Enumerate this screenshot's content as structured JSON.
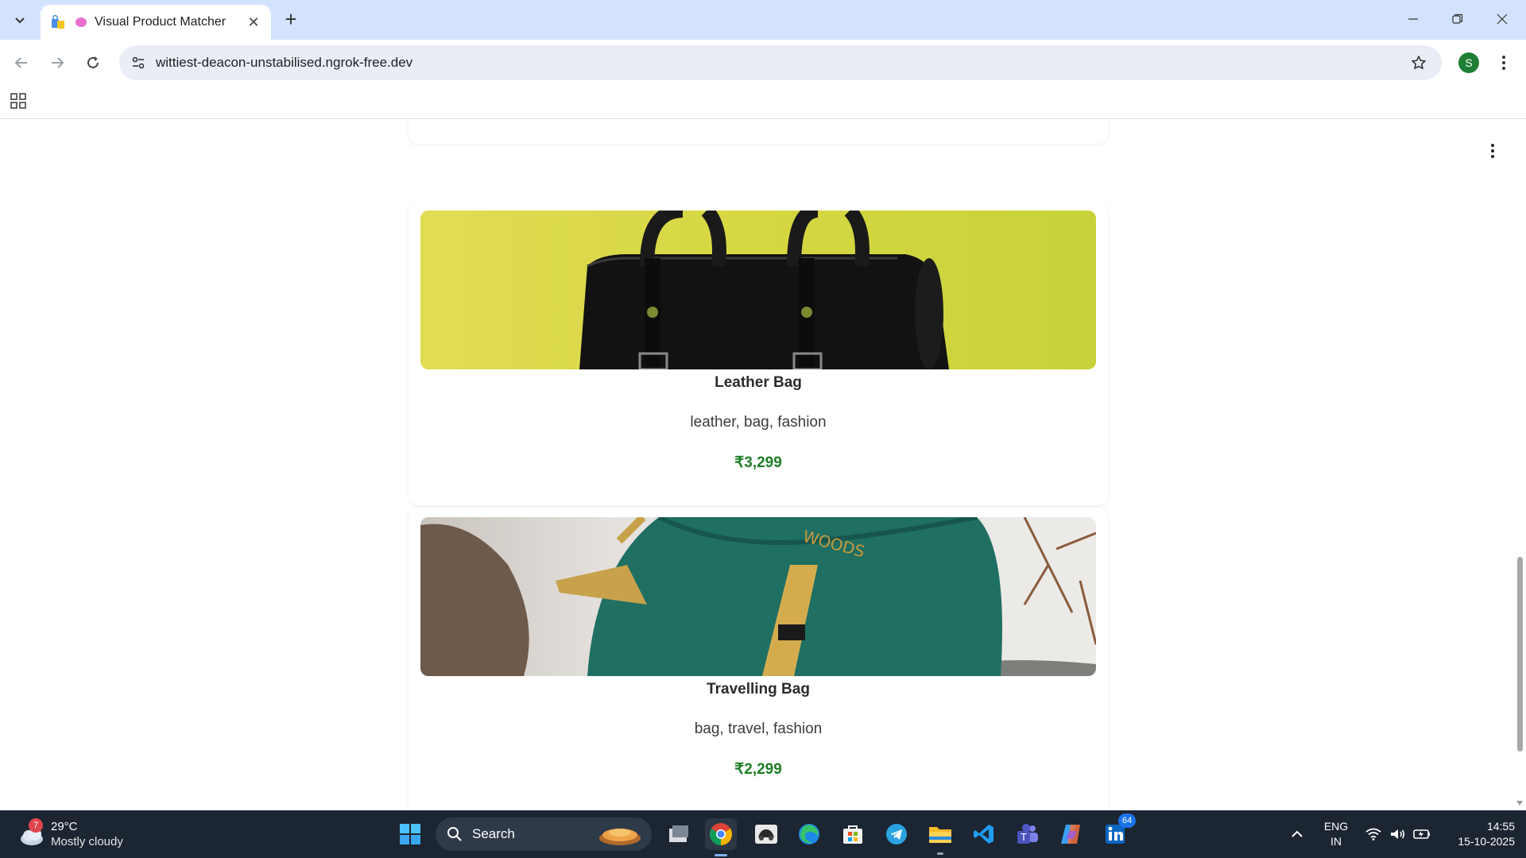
{
  "browser": {
    "tab": {
      "title": "Visual Product Matcher"
    },
    "url": "wittiest-deacon-unstabilised.ngrok-free.dev",
    "profile_initial": "S"
  },
  "products": [
    {
      "name": "Leather Bag",
      "tags": "leather, bag, fashion",
      "price": "₹3,299",
      "image": "black-leather-bag-on-yellow"
    },
    {
      "name": "Travelling Bag",
      "tags": "bag, travel, fashion",
      "price": "₹2,299",
      "image": "green-backpack-outdoors"
    }
  ],
  "taskbar": {
    "weather": {
      "temp": "29°C",
      "condition": "Mostly cloudy",
      "badge": "7"
    },
    "search_label": "Search",
    "linkedin_badge": "64",
    "language": {
      "line1": "ENG",
      "line2": "IN"
    },
    "clock": {
      "time": "14:55",
      "date": "15-10-2025"
    }
  },
  "colors": {
    "titlebar": "#d3e3fd",
    "price": "#1e7e26",
    "taskbar": "#1c2532"
  }
}
